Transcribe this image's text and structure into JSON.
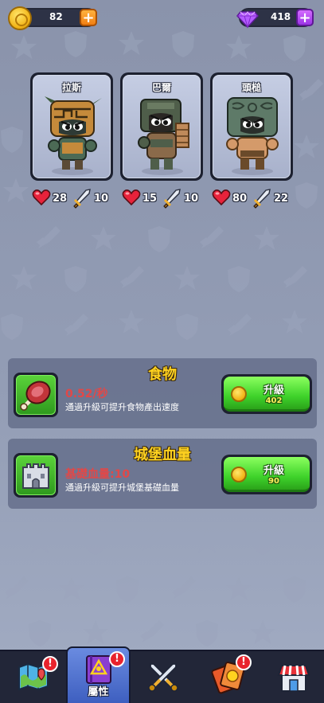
{
  "currency": {
    "coins": "82",
    "gems": "418",
    "coin_icon": "coin-icon",
    "gem_icon": "gem-icon"
  },
  "heroes": [
    {
      "name": "拉斯",
      "hp": "28",
      "attack": "10"
    },
    {
      "name": "巴爾",
      "hp": "15",
      "attack": "10"
    },
    {
      "name": "頭槌",
      "hp": "80",
      "attack": "22"
    }
  ],
  "upgrades": {
    "food": {
      "title": "食物",
      "value": "0.52/秒",
      "description": "通過升級可提升食物產出速度",
      "button_label": "升級",
      "cost": "402"
    },
    "castle": {
      "title": "城堡血量",
      "value": "基礎血量:10",
      "description": "通過升級可提升城堡基礎血量",
      "button_label": "升級",
      "cost": "90"
    }
  },
  "nav": {
    "items": [
      {
        "id": "map",
        "label": "",
        "badge": "!"
      },
      {
        "id": "attributes",
        "label": "屬性",
        "badge": "!"
      },
      {
        "id": "battle",
        "label": "",
        "badge": ""
      },
      {
        "id": "cards",
        "label": "",
        "badge": "!"
      },
      {
        "id": "shop",
        "label": "",
        "badge": ""
      }
    ]
  },
  "colors": {
    "accent_gold": "#ffd21f",
    "value_red": "#e14848",
    "upgrade_green": "#3fd32b",
    "active_tab": "#4e6fd0"
  }
}
